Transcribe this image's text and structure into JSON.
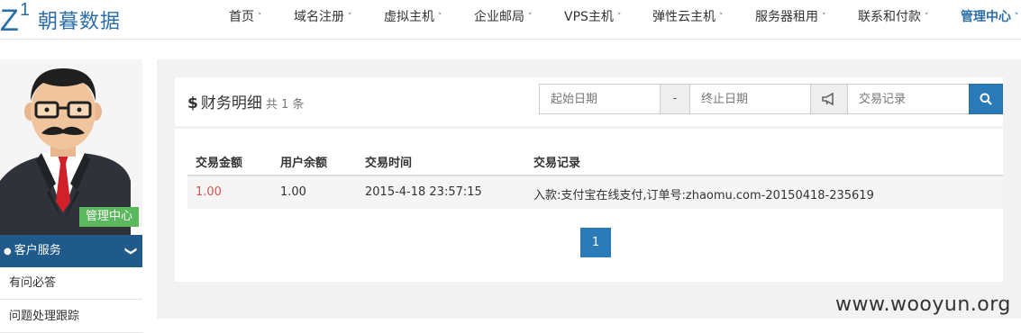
{
  "brand": {
    "mark_z": "Z",
    "mark_one": "1",
    "name": "朝暮数据"
  },
  "nav": [
    {
      "label": "首页"
    },
    {
      "label": "域名注册"
    },
    {
      "label": "虚拟主机"
    },
    {
      "label": "企业邮局"
    },
    {
      "label": "VPS主机"
    },
    {
      "label": "弹性云主机"
    },
    {
      "label": "服务器租用"
    },
    {
      "label": "联系和付款"
    },
    {
      "label": "管理中心"
    }
  ],
  "caret": "˅",
  "sidebar": {
    "badge": "管理中心",
    "menu_title": "客户服务",
    "menu_chevron": "❯",
    "items": [
      {
        "label": "有问必答"
      },
      {
        "label": "问题处理跟踪"
      }
    ]
  },
  "panel": {
    "dollar": "$",
    "title": "财务明细",
    "count": "共 1 条",
    "filters": {
      "start_placeholder": "起始日期",
      "separator": "-",
      "end_placeholder": "终止日期",
      "record_placeholder": "交易记录"
    }
  },
  "table": {
    "headers": [
      "交易金额",
      "用户余额",
      "交易时间",
      "交易记录"
    ],
    "rows": [
      {
        "amount": "1.00",
        "balance": "1.00",
        "time": "2015-4-18 23:57:15",
        "record": "入款:支付宝在线支付,订单号:zhaomu.com-20150418-235619"
      }
    ]
  },
  "pagination": {
    "current": "1"
  },
  "watermark": "www.wooyun.org",
  "colors": {
    "brand": "#2b6ea8",
    "primary": "#2b7ab8",
    "sidebar_head": "#1f5a8a",
    "badge": "#5cb85c",
    "amount_red": "#d9534f"
  }
}
